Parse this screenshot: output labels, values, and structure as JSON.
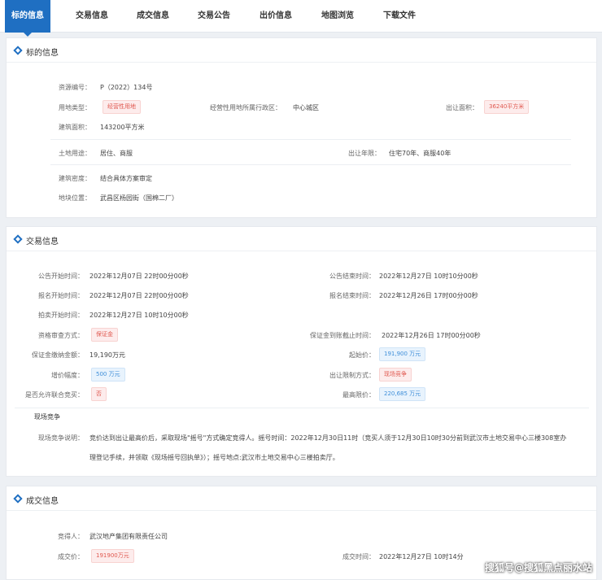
{
  "tabs": [
    "标的信息",
    "交易信息",
    "成交信息",
    "交易公告",
    "出价信息",
    "地图浏览",
    "下载文件"
  ],
  "target_info": {
    "title": "标的信息",
    "resource_no_label": "资源编号：",
    "resource_no": "P（2022）134号",
    "land_type_label": "用地类型：",
    "land_type": "经营性用地",
    "district_label": "经营性用地所属行政区：",
    "district": "中心城区",
    "area_label": "出让面积：",
    "area": "36240平方米",
    "building_area_label": "建筑面积：",
    "building_area": "143200平方米",
    "land_use_label": "土地用途：",
    "land_use": "居住、商服",
    "term_label": "出让年限：",
    "term": "住宅70年、商服40年",
    "density_label": "建筑密度：",
    "density": "结合具体方案审定",
    "location_label": "地块位置：",
    "location": "武昌区杨园街（国棉二厂）"
  },
  "trade_info": {
    "title": "交易信息",
    "notice_start_label": "公告开始时间：",
    "notice_start": "2022年12月07日 22时00分00秒",
    "notice_end_label": "公告结束时间：",
    "notice_end": "2022年12月27日 10时10分00秒",
    "signup_start_label": "报名开始时间：",
    "signup_start": "2022年12月07日 22时00分00秒",
    "signup_end_label": "报名结束时间：",
    "signup_end": "2022年12月26日 17时00分00秒",
    "auction_start_label": "拍卖开始时间：",
    "auction_start": "2022年12月27日 10时10分00秒",
    "qual_label": "资格审查方式：",
    "qual": "保证金",
    "deposit_deadline_label": "保证金到账截止时间：",
    "deposit_deadline": "2022年12月26日 17时00分00秒",
    "deposit_label": "保证金缴纳金额：",
    "deposit": "19,190万元",
    "start_price_label": "起始价：",
    "start_price": "191,900 万元",
    "increment_label": "增价幅度：",
    "increment": "500 万元",
    "limit_label": "出让限制方式：",
    "limit": "现场竞争",
    "joint_label": "是否允许联合竞买：",
    "joint": "否",
    "max_price_label": "最高限价：",
    "max_price": "220,685 万元",
    "site_heading": "现场竞争",
    "site_desc_label": "现场竞争说明：",
    "site_desc_1": "竞价达到出让最高价后，采取现场\"摇号\"方式确定竞得人。摇号时间：2022年12月30日11时（竞买人须于12月30日10时30分前到武汉市土地交易中心三楼308室办",
    "site_desc_2": "理登记手续，并领取《现场摇号回执单》）；摇号地点:武汉市土地交易中心三楼拍卖厅。"
  },
  "deal_info": {
    "title": "成交信息",
    "winner_label": "竞得人：",
    "winner": "武汉地产集团有限责任公司",
    "price_label": "成交价：",
    "price": "191900万元",
    "time_label": "成交时间：",
    "time": "2022年12月27日 10时14分"
  },
  "watermark": "搜狐号@搜狐黑点丽水站",
  "colors": {
    "accent": "#1f6fc2",
    "tag_red": "#e0584f",
    "tag_blue": "#3f8fd9"
  },
  "icons": [
    "diamond-icon"
  ]
}
